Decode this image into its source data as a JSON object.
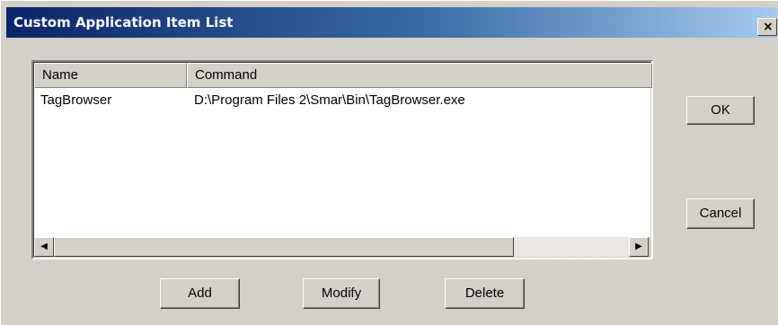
{
  "window": {
    "title": "Custom Application Item List",
    "close_glyph": "×"
  },
  "list": {
    "columns": [
      "Name",
      "Command"
    ],
    "rows": [
      {
        "name": "TagBrowser",
        "command": "D:\\Program Files 2\\Smar\\Bin\\TagBrowser.exe"
      }
    ]
  },
  "scrollbar": {
    "left_arrow": "◀",
    "right_arrow": "▶"
  },
  "buttons": {
    "ok": "OK",
    "cancel": "Cancel",
    "add": "Add",
    "modify": "Modify",
    "delete": "Delete"
  },
  "colors": {
    "face": "#d4d0c8",
    "title_start": "#0a246a",
    "title_end": "#a6caf0"
  }
}
